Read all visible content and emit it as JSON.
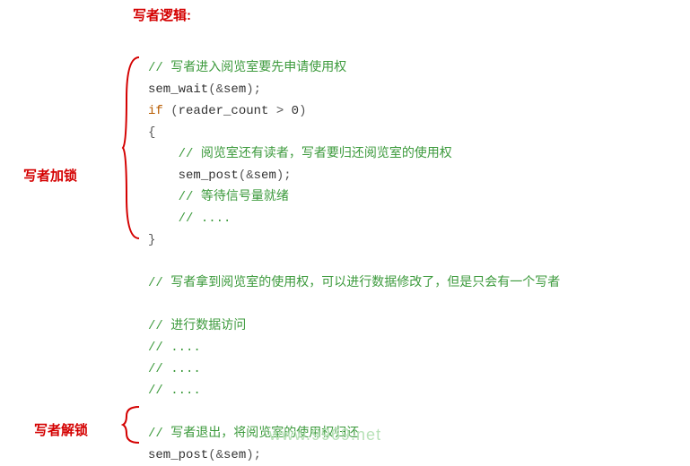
{
  "title": "写者逻辑:",
  "labels": {
    "lock": "写者加锁",
    "unlock": "写者解锁"
  },
  "code": {
    "c1": "// 写者进入阅览室要先申请使用权",
    "l2a": "sem_wait",
    "l2b": "(&",
    "l2c": "sem",
    "l2d": ");",
    "l3a": "if",
    "l3b": " (",
    "l3c": "reader_count",
    "l3d": " > ",
    "l3e": "0",
    "l3f": ")",
    "l4": "{",
    "c5": "// 阅览室还有读者，写者要归还阅览室的使用权",
    "l6a": "sem_post",
    "l6b": "(&",
    "l6c": "sem",
    "l6d": ");",
    "c7": "// 等待信号量就绪",
    "c8": "// ....",
    "l9": "}",
    "c10": "// 写者拿到阅览室的使用权，可以进行数据修改了，但是只会有一个写者",
    "c11": "// 进行数据访问",
    "c12": "// ....",
    "c13": "// ....",
    "c14": "// ....",
    "c15": "// 写者退出，将阅览室的使用权归还",
    "l16a": "sem_post",
    "l16b": "(&",
    "l16c": "sem",
    "l16d": ");"
  },
  "watermark": "www.9969.net"
}
